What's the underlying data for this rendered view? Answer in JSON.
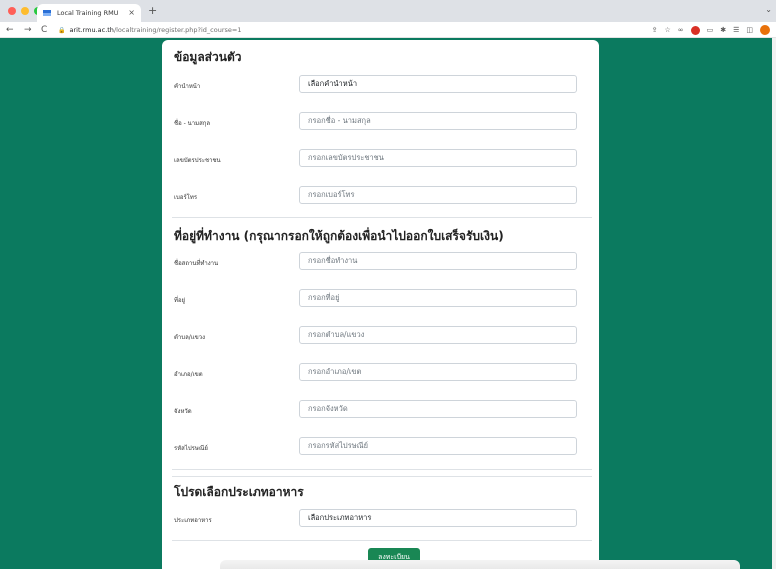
{
  "browser": {
    "tab_title": "Local Training RMU",
    "tab_close": "×",
    "new_tab": "+",
    "tab_search": "⌄",
    "back": "←",
    "forward": "→",
    "reload": "C",
    "url_host": "arit.rmu.ac.th",
    "url_path": "/localtraining/register.php?id_course=1",
    "toolbar_icons": [
      "share-icon",
      "star-icon",
      "extension-icon",
      "adblock-icon",
      "window-icon",
      "puzzle-icon",
      "reading-list-icon",
      "split-icon",
      "profile-icon"
    ]
  },
  "personal": {
    "title": "ข้อมูลส่วนตัว",
    "prefix_label": "คำนำหน้า",
    "prefix_value": "เลือกคำนำหน้า",
    "name_label": "ชื่อ - นามสกุล",
    "name_placeholder": "กรอกชื่อ - นามสกุล",
    "id_label": "เลขบัตรประชาชน",
    "id_placeholder": "กรอกเลขบัตรประชาชน",
    "phone_label": "เบอร์โทร",
    "phone_placeholder": "กรอกเบอร์โทร"
  },
  "workplace": {
    "title": "ที่อยู่ที่ทำงาน (กรุณากรอกให้ถูกต้องเพื่อนำไปออกใบเสร็จรับเงิน)",
    "name_label": "ชื่อสถานที่ทำงาน",
    "name_placeholder": "กรอกชื่อทำงาน",
    "address_label": "ที่อยู่",
    "address_placeholder": "กรอกที่อยู่",
    "subdistrict_label": "ตำบล/แขวง",
    "subdistrict_placeholder": "กรอกตำบล/แขวง",
    "district_label": "อำเภอ/เขต",
    "district_placeholder": "กรอกอำเภอ/เขต",
    "province_label": "จังหวัด",
    "province_placeholder": "กรอกจังหวัด",
    "postal_label": "รหัสไปรษณีย์",
    "postal_placeholder": "กรอกรหัสไปรษณีย์"
  },
  "food": {
    "title": "โปรดเลือกประเภทอาหาร",
    "type_label": "ประเภทอาหาร",
    "type_value": "เลือกประเภทอาหาร"
  },
  "submit_label": "ลงทะเบียน",
  "colors": {
    "page_background": "#0b7a5f",
    "submit_button": "#198754"
  }
}
